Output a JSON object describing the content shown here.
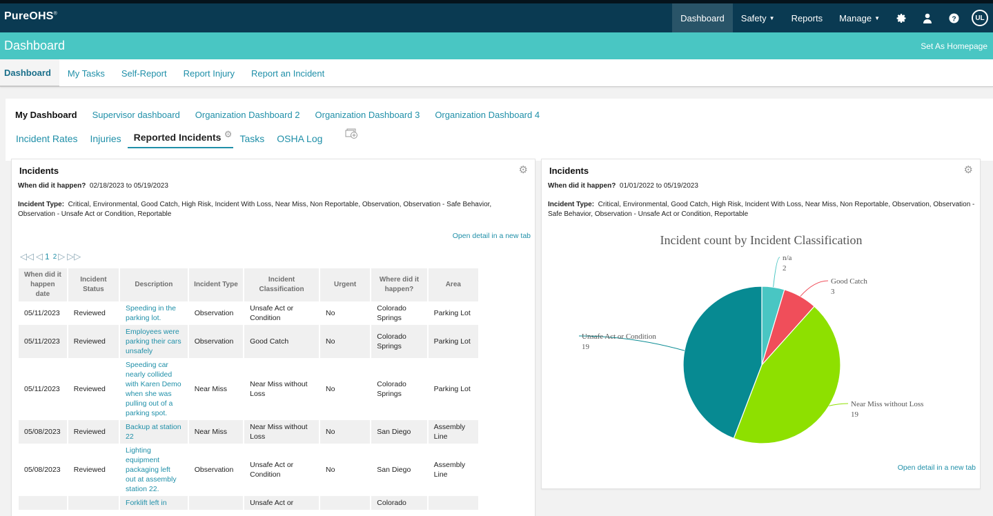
{
  "app": {
    "logo": "PureOHS",
    "logo_mark": "®"
  },
  "topnav": {
    "items": [
      {
        "label": "Dashboard",
        "active": true
      },
      {
        "label": "Safety",
        "caret": true
      },
      {
        "label": "Reports"
      },
      {
        "label": "Manage",
        "caret": true
      }
    ],
    "icons": [
      "gear-icon",
      "user-icon",
      "help-icon",
      "ul-logo-icon"
    ],
    "ul_label": "UL"
  },
  "titlebar": {
    "title": "Dashboard",
    "set_homepage": "Set As Homepage"
  },
  "subnav": {
    "items": [
      "Dashboard",
      "My Tasks",
      "Self-Report",
      "Report Injury",
      "Report an Incident"
    ]
  },
  "dashboards": {
    "items": [
      "My Dashboard",
      "Supervisor dashboard",
      "Organization Dashboard 2",
      "Organization Dashboard 3",
      "Organization Dashboard 4"
    ]
  },
  "widget_tabs": {
    "items": [
      "Incident Rates",
      "Injuries",
      "Reported Incidents",
      "Tasks",
      "OSHA Log"
    ],
    "active_index": 2
  },
  "left_panel": {
    "title": "Incidents",
    "when_label": "When did it happen?",
    "when_value": "02/18/2023 to 05/19/2023",
    "type_label": "Incident Type:",
    "type_value": "Critical, Environmental, Good Catch, High Risk, Incident With Loss, Near Miss, Non Reportable, Observation, Observation - Safe Behavior, Observation - Unsafe Act or Condition, Reportable",
    "open_detail": "Open detail in a new tab",
    "pager": {
      "pages": [
        "1",
        "2"
      ],
      "current": "1"
    },
    "table": {
      "headers": [
        "When did it happen date",
        "Incident Status",
        "Description",
        "Incident Type",
        "Incident Classification",
        "Urgent",
        "Where did it happen?",
        "Area"
      ],
      "rows": [
        [
          "05/11/2023",
          "Reviewed",
          "Speeding in the parking lot.",
          "Observation",
          "Unsafe Act or Condition",
          "No",
          "Colorado Springs",
          "Parking Lot"
        ],
        [
          "05/11/2023",
          "Reviewed",
          "Employees were parking their cars unsafely",
          "Observation",
          "Good Catch",
          "No",
          "Colorado Springs",
          "Parking Lot"
        ],
        [
          "05/11/2023",
          "Reviewed",
          "Speeding car nearly collided with Karen Demo when she was pulling out of a parking spot.",
          "Near Miss",
          "Near Miss without Loss",
          "No",
          "Colorado Springs",
          "Parking Lot"
        ],
        [
          "05/08/2023",
          "Reviewed",
          "Backup at station 22",
          "Near Miss",
          "Near Miss without Loss",
          "No",
          "San Diego",
          "Assembly Line"
        ],
        [
          "05/08/2023",
          "Reviewed",
          "Lighting equipment packaging left out at assembly station 22.",
          "Observation",
          "Unsafe Act or Condition",
          "No",
          "San Diego",
          "Assembly Line"
        ],
        [
          "",
          "",
          "Forklift left in",
          "",
          "Unsafe Act or",
          "",
          "Colorado",
          ""
        ]
      ]
    }
  },
  "right_panel": {
    "title": "Incidents",
    "when_label": "When did it happen?",
    "when_value": "01/01/2022 to 05/19/2023",
    "type_label": "Incident Type:",
    "type_value": "Critical, Environmental, Good Catch, High Risk, Incident With Loss, Near Miss, Non Reportable, Observation, Observation - Safe Behavior, Observation - Unsafe Act or Condition, Reportable",
    "open_detail": "Open detail in a new tab"
  },
  "chart_data": {
    "type": "pie",
    "title": "Incident count by Incident Classification",
    "slices": [
      {
        "label": "n/a",
        "value": 2,
        "color": "#49c6c3"
      },
      {
        "label": "Good Catch",
        "value": 3,
        "color": "#f04e5a"
      },
      {
        "label": "Near Miss without Loss",
        "value": 19,
        "color": "#8ee000"
      },
      {
        "label": "Unsafe Act or Condition",
        "value": 19,
        "color": "#078a92"
      }
    ]
  },
  "colors": {
    "topbar": "#0a3a52",
    "titlebar": "#49c6c3",
    "link": "#1f8fa8"
  }
}
